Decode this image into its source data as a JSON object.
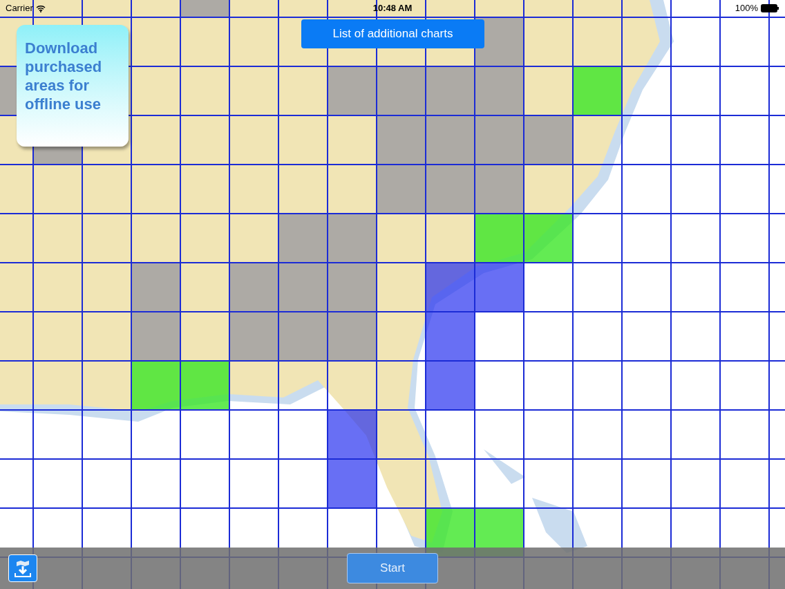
{
  "status_bar": {
    "carrier": "Carrier",
    "time": "10:48 AM",
    "battery": "100%"
  },
  "charts_button": {
    "label": "List of additional charts"
  },
  "hint_card": {
    "text": "Download purchased areas for offline use"
  },
  "grid": {
    "rows": [
      [
        {
          "kind": "plain"
        },
        {
          "kind": "plain"
        },
        {
          "kind": "plain"
        },
        {
          "kind": "plain"
        },
        {
          "kind": "gray"
        },
        {
          "kind": "plain"
        },
        {
          "kind": "plain"
        },
        {
          "kind": "plain"
        },
        {
          "kind": "plain"
        },
        {
          "kind": "plain"
        },
        {
          "kind": "plain"
        },
        {
          "kind": "plain"
        },
        {
          "kind": "plain"
        },
        {
          "kind": "plain"
        },
        {
          "kind": "plain"
        },
        {
          "kind": "plain"
        },
        {
          "kind": "plain"
        }
      ],
      [
        {
          "kind": "plain"
        },
        {
          "kind": "plain"
        },
        {
          "kind": "plain"
        },
        {
          "kind": "plain"
        },
        {
          "kind": "plain"
        },
        {
          "kind": "plain"
        },
        {
          "kind": "plain"
        },
        {
          "kind": "plain"
        },
        {
          "kind": "plain"
        },
        {
          "kind": "plain"
        },
        {
          "kind": "gray"
        },
        {
          "kind": "plain"
        },
        {
          "kind": "plain"
        },
        {
          "kind": "plain"
        },
        {
          "kind": "plain"
        },
        {
          "kind": "plain"
        },
        {
          "kind": "plain"
        }
      ],
      [
        {
          "kind": "gray"
        },
        {
          "kind": "plain"
        },
        {
          "kind": "plain"
        },
        {
          "kind": "plain"
        },
        {
          "kind": "plain"
        },
        {
          "kind": "plain"
        },
        {
          "kind": "plain"
        },
        {
          "kind": "gray"
        },
        {
          "kind": "gray"
        },
        {
          "kind": "gray"
        },
        {
          "kind": "gray"
        },
        {
          "kind": "plain"
        },
        {
          "kind": "green"
        },
        {
          "kind": "plain"
        },
        {
          "kind": "plain"
        },
        {
          "kind": "plain"
        },
        {
          "kind": "plain"
        }
      ],
      [
        {
          "kind": "plain"
        },
        {
          "kind": "gray"
        },
        {
          "kind": "plain"
        },
        {
          "kind": "plain"
        },
        {
          "kind": "plain"
        },
        {
          "kind": "plain"
        },
        {
          "kind": "plain"
        },
        {
          "kind": "plain"
        },
        {
          "kind": "gray"
        },
        {
          "kind": "gray"
        },
        {
          "kind": "gray"
        },
        {
          "kind": "gray"
        },
        {
          "kind": "plain"
        },
        {
          "kind": "plain"
        },
        {
          "kind": "plain"
        },
        {
          "kind": "plain"
        },
        {
          "kind": "plain"
        }
      ],
      [
        {
          "kind": "plain"
        },
        {
          "kind": "plain"
        },
        {
          "kind": "plain"
        },
        {
          "kind": "plain"
        },
        {
          "kind": "plain"
        },
        {
          "kind": "plain"
        },
        {
          "kind": "plain"
        },
        {
          "kind": "plain"
        },
        {
          "kind": "gray"
        },
        {
          "kind": "gray"
        },
        {
          "kind": "gray"
        },
        {
          "kind": "plain"
        },
        {
          "kind": "plain"
        },
        {
          "kind": "plain"
        },
        {
          "kind": "plain"
        },
        {
          "kind": "plain"
        },
        {
          "kind": "plain"
        }
      ],
      [
        {
          "kind": "plain"
        },
        {
          "kind": "plain"
        },
        {
          "kind": "plain"
        },
        {
          "kind": "plain"
        },
        {
          "kind": "plain"
        },
        {
          "kind": "plain"
        },
        {
          "kind": "gray"
        },
        {
          "kind": "gray"
        },
        {
          "kind": "plain"
        },
        {
          "kind": "plain"
        },
        {
          "kind": "green"
        },
        {
          "kind": "green"
        },
        {
          "kind": "plain"
        },
        {
          "kind": "plain"
        },
        {
          "kind": "plain"
        },
        {
          "kind": "plain"
        },
        {
          "kind": "plain"
        }
      ],
      [
        {
          "kind": "plain"
        },
        {
          "kind": "plain"
        },
        {
          "kind": "plain"
        },
        {
          "kind": "gray"
        },
        {
          "kind": "plain"
        },
        {
          "kind": "gray"
        },
        {
          "kind": "gray"
        },
        {
          "kind": "gray"
        },
        {
          "kind": "plain"
        },
        {
          "kind": "blue"
        },
        {
          "kind": "blue"
        },
        {
          "kind": "plain"
        },
        {
          "kind": "plain"
        },
        {
          "kind": "plain"
        },
        {
          "kind": "plain"
        },
        {
          "kind": "plain"
        },
        {
          "kind": "plain"
        }
      ],
      [
        {
          "kind": "plain"
        },
        {
          "kind": "plain"
        },
        {
          "kind": "plain"
        },
        {
          "kind": "gray"
        },
        {
          "kind": "plain"
        },
        {
          "kind": "gray"
        },
        {
          "kind": "gray"
        },
        {
          "kind": "gray"
        },
        {
          "kind": "plain"
        },
        {
          "kind": "blue"
        },
        {
          "kind": "plain"
        },
        {
          "kind": "plain"
        },
        {
          "kind": "plain"
        },
        {
          "kind": "plain"
        },
        {
          "kind": "plain"
        },
        {
          "kind": "plain"
        },
        {
          "kind": "plain"
        }
      ],
      [
        {
          "kind": "plain"
        },
        {
          "kind": "plain"
        },
        {
          "kind": "plain"
        },
        {
          "kind": "green"
        },
        {
          "kind": "green"
        },
        {
          "kind": "plain"
        },
        {
          "kind": "plain"
        },
        {
          "kind": "plain"
        },
        {
          "kind": "plain"
        },
        {
          "kind": "blue"
        },
        {
          "kind": "plain"
        },
        {
          "kind": "plain"
        },
        {
          "kind": "plain"
        },
        {
          "kind": "plain"
        },
        {
          "kind": "plain"
        },
        {
          "kind": "plain"
        },
        {
          "kind": "plain"
        }
      ],
      [
        {
          "kind": "plain"
        },
        {
          "kind": "plain"
        },
        {
          "kind": "plain"
        },
        {
          "kind": "plain"
        },
        {
          "kind": "plain"
        },
        {
          "kind": "plain"
        },
        {
          "kind": "plain"
        },
        {
          "kind": "blue"
        },
        {
          "kind": "plain"
        },
        {
          "kind": "plain"
        },
        {
          "kind": "plain"
        },
        {
          "kind": "plain"
        },
        {
          "kind": "plain"
        },
        {
          "kind": "plain"
        },
        {
          "kind": "plain"
        },
        {
          "kind": "plain"
        },
        {
          "kind": "plain"
        }
      ],
      [
        {
          "kind": "plain"
        },
        {
          "kind": "plain"
        },
        {
          "kind": "plain"
        },
        {
          "kind": "plain"
        },
        {
          "kind": "plain"
        },
        {
          "kind": "plain"
        },
        {
          "kind": "plain"
        },
        {
          "kind": "blue"
        },
        {
          "kind": "plain"
        },
        {
          "kind": "plain"
        },
        {
          "kind": "plain"
        },
        {
          "kind": "plain"
        },
        {
          "kind": "plain"
        },
        {
          "kind": "plain"
        },
        {
          "kind": "plain"
        },
        {
          "kind": "plain"
        },
        {
          "kind": "plain"
        }
      ],
      [
        {
          "kind": "plain"
        },
        {
          "kind": "plain"
        },
        {
          "kind": "plain"
        },
        {
          "kind": "plain"
        },
        {
          "kind": "plain"
        },
        {
          "kind": "plain"
        },
        {
          "kind": "plain"
        },
        {
          "kind": "plain"
        },
        {
          "kind": "plain"
        },
        {
          "kind": "green"
        },
        {
          "kind": "green"
        },
        {
          "kind": "plain"
        },
        {
          "kind": "plain"
        },
        {
          "kind": "plain"
        },
        {
          "kind": "plain"
        },
        {
          "kind": "plain"
        },
        {
          "kind": "plain"
        }
      ]
    ]
  },
  "bottom_bar": {
    "start_button": {
      "label": "Start"
    }
  }
}
